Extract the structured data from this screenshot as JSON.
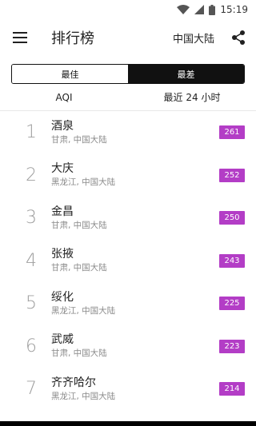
{
  "status_bar": {
    "time": "15:19",
    "icons": [
      "wifi-icon",
      "signal-icon",
      "battery-icon"
    ]
  },
  "app_bar": {
    "title": "排行榜",
    "region": "中国大陆",
    "icons": [
      "menu-icon",
      "share-icon"
    ]
  },
  "toggle": {
    "options": [
      {
        "label": "最佳",
        "active": false
      },
      {
        "label": "最差",
        "active": true
      }
    ]
  },
  "sub_header": {
    "metric": "AQI",
    "period": "最近 24 小时"
  },
  "rankings": [
    {
      "rank": "1",
      "city": "酒泉",
      "region": "甘肃, 中国大陆",
      "aqi": "261"
    },
    {
      "rank": "2",
      "city": "大庆",
      "region": "黑龙江, 中国大陆",
      "aqi": "252"
    },
    {
      "rank": "3",
      "city": "金昌",
      "region": "甘肃, 中国大陆",
      "aqi": "250"
    },
    {
      "rank": "4",
      "city": "张掖",
      "region": "甘肃, 中国大陆",
      "aqi": "243"
    },
    {
      "rank": "5",
      "city": "绥化",
      "region": "黑龙江, 中国大陆",
      "aqi": "225"
    },
    {
      "rank": "6",
      "city": "武威",
      "region": "甘肃, 中国大陆",
      "aqi": "223"
    },
    {
      "rank": "7",
      "city": "齐齐哈尔",
      "region": "黑龙江, 中国大陆",
      "aqi": "214"
    }
  ],
  "colors": {
    "aqi_badge": "#b33dc6",
    "toggle_active": "#111111"
  }
}
